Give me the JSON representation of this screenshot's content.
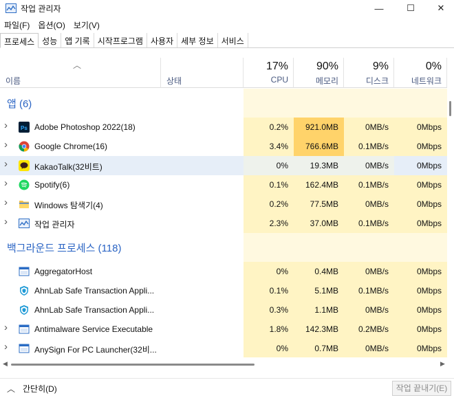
{
  "window": {
    "title": "작업 관리자",
    "minimize": "—",
    "maximize": "☐",
    "close": "✕"
  },
  "menu": [
    "파일(F)",
    "옵션(O)",
    "보기(V)"
  ],
  "tabs": [
    "프로세스",
    "성능",
    "앱 기록",
    "시작프로그램",
    "사용자",
    "세부 정보",
    "서비스"
  ],
  "columns": {
    "name": "이름",
    "status": "상태",
    "cpu": {
      "pct": "17%",
      "label": "CPU"
    },
    "memory": {
      "pct": "90%",
      "label": "메모리"
    },
    "disk": {
      "pct": "9%",
      "label": "디스크"
    },
    "network": {
      "pct": "0%",
      "label": "네트워크"
    }
  },
  "groups": {
    "apps": "앱 (6)",
    "background": "백그라운드 프로세스 (118)"
  },
  "apps": [
    {
      "name": "Adobe Photoshop 2022(18)",
      "icon": "photoshop-icon",
      "cpu": "0.2%",
      "mem": "921.0MB",
      "disk": "0MB/s",
      "net": "0Mbps",
      "mem_hot": true
    },
    {
      "name": "Google Chrome(16)",
      "icon": "chrome-icon",
      "cpu": "3.4%",
      "mem": "766.6MB",
      "disk": "0.1MB/s",
      "net": "0Mbps",
      "mem_hot": true
    },
    {
      "name": "KakaoTalk(32비트)",
      "icon": "kakaotalk-icon",
      "cpu": "0%",
      "mem": "19.3MB",
      "disk": "0MB/s",
      "net": "0Mbps",
      "selected": true
    },
    {
      "name": "Spotify(6)",
      "icon": "spotify-icon",
      "cpu": "0.1%",
      "mem": "162.4MB",
      "disk": "0.1MB/s",
      "net": "0Mbps"
    },
    {
      "name": "Windows 탐색기(4)",
      "icon": "folder-icon",
      "cpu": "0.2%",
      "mem": "77.5MB",
      "disk": "0MB/s",
      "net": "0Mbps"
    },
    {
      "name": "작업 관리자",
      "icon": "task-manager-icon",
      "cpu": "2.3%",
      "mem": "37.0MB",
      "disk": "0.1MB/s",
      "net": "0Mbps"
    }
  ],
  "background": [
    {
      "name": "AggregatorHost",
      "icon": "app-window-icon",
      "cpu": "0%",
      "mem": "0.4MB",
      "disk": "0MB/s",
      "net": "0Mbps",
      "expandable": false
    },
    {
      "name": "AhnLab Safe Transaction Appli...",
      "icon": "ahnlab-shield-icon",
      "cpu": "0.1%",
      "mem": "5.1MB",
      "disk": "0.1MB/s",
      "net": "0Mbps",
      "expandable": false
    },
    {
      "name": "AhnLab Safe Transaction Appli...",
      "icon": "ahnlab-shield-icon",
      "cpu": "0.3%",
      "mem": "1.1MB",
      "disk": "0MB/s",
      "net": "0Mbps",
      "expandable": false
    },
    {
      "name": "Antimalware Service Executable",
      "icon": "app-window-icon",
      "cpu": "1.8%",
      "mem": "142.3MB",
      "disk": "0.2MB/s",
      "net": "0Mbps",
      "expandable": true
    },
    {
      "name": "AnySign For PC Launcher(32비...",
      "icon": "app-window-icon",
      "cpu": "0%",
      "mem": "0.7MB",
      "disk": "0MB/s",
      "net": "0Mbps",
      "expandable": true
    }
  ],
  "footer": {
    "collapse": "간단히(D)",
    "end_task": "작업 끝내기(E)"
  },
  "colors": {
    "cell_light": "#fff4c4",
    "cell_pale": "#fff9e0",
    "cell_hot": "#ffd36a",
    "group_blue": "#2a64c4",
    "selected": "#e6eef8"
  }
}
